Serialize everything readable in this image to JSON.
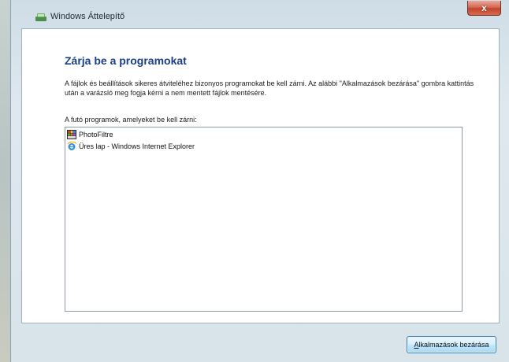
{
  "window": {
    "title": "Windows Áttelepítő",
    "close_glyph": "x"
  },
  "main": {
    "heading": "Zárja be a programokat",
    "description": "A fájlok és beállítások sikeres átviteléhez bizonyos programokat be kell zárni. Az alábbi \"Alkalmazások bezárása\" gombra kattintás után a varázsló meg fogja kérni a nem mentett fájlok mentésére.",
    "list_label": "A futó programok, amelyeket be kell zárni:",
    "programs": [
      {
        "label": "PhotoFiltre",
        "icon": "photofiltre-icon"
      },
      {
        "label": "Üres lap - Windows Internet Explorer",
        "icon": "internet-explorer-icon"
      }
    ]
  },
  "footer": {
    "close_apps_label_first": "A",
    "close_apps_label_rest": "lkalmazások bezárása"
  },
  "colors": {
    "heading": "#1a3e8a",
    "close_button": "#c1442b",
    "primary_button_border": "#3c7fb1"
  }
}
